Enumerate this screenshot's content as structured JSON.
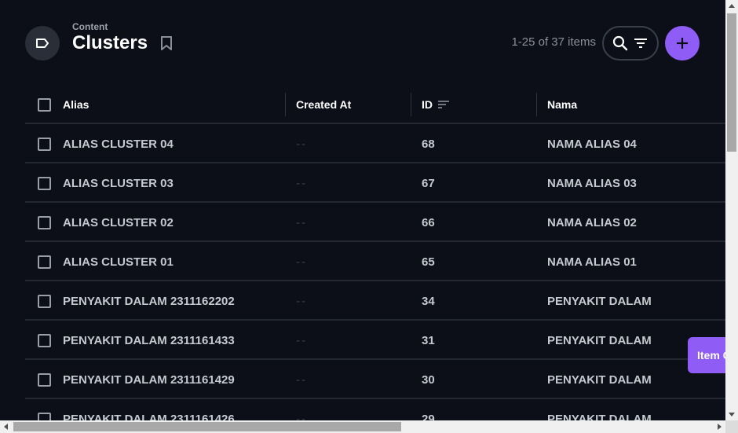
{
  "header": {
    "breadcrumb": "Content",
    "title": "Clusters",
    "item_count": "1-25 of 37 items"
  },
  "table": {
    "columns": [
      {
        "label": "Alias"
      },
      {
        "label": "Created At"
      },
      {
        "label": "ID",
        "sorted": true
      },
      {
        "label": "Nama"
      }
    ],
    "rows": [
      {
        "alias": "ALIAS CLUSTER 04",
        "created_at": "--",
        "id": "68",
        "nama": "NAMA ALIAS 04"
      },
      {
        "alias": "ALIAS CLUSTER 03",
        "created_at": "--",
        "id": "67",
        "nama": "NAMA ALIAS 03"
      },
      {
        "alias": "ALIAS CLUSTER 02",
        "created_at": "--",
        "id": "66",
        "nama": "NAMA ALIAS 02"
      },
      {
        "alias": "ALIAS CLUSTER 01",
        "created_at": "--",
        "id": "65",
        "nama": "NAMA ALIAS 01"
      },
      {
        "alias": "PENYAKIT DALAM 2311162202",
        "created_at": "--",
        "id": "34",
        "nama": "PENYAKIT DALAM"
      },
      {
        "alias": "PENYAKIT DALAM 2311161433",
        "created_at": "--",
        "id": "31",
        "nama": "PENYAKIT DALAM"
      },
      {
        "alias": "PENYAKIT DALAM 2311161429",
        "created_at": "--",
        "id": "30",
        "nama": "PENYAKIT DALAM"
      },
      {
        "alias": "PENYAKIT DALAM 2311161426",
        "created_at": "--",
        "id": "29",
        "nama": "PENYAKIT DALAM"
      }
    ]
  },
  "toast": {
    "text": "Item Created"
  },
  "icons": {
    "breadcrumb": "label-icon",
    "bookmark": "bookmark-icon",
    "search": "search-icon",
    "filter": "filter-icon",
    "add": "plus-icon",
    "sort": "sort-icon"
  },
  "colors": {
    "background": "#0c0f17",
    "accent": "#8f5cf5",
    "muted_text": "#8a8f99"
  }
}
